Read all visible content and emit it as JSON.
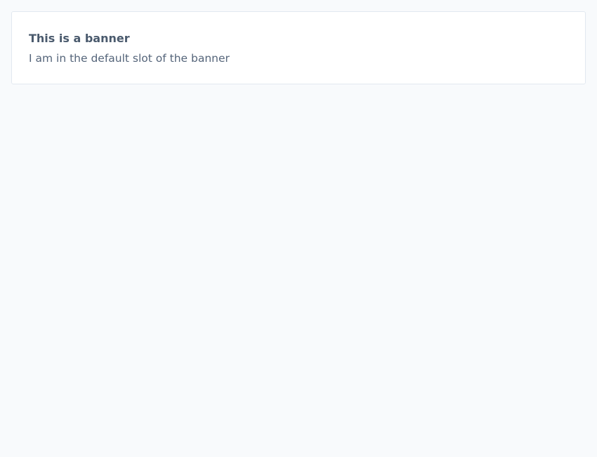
{
  "banner": {
    "title": "This is a banner",
    "body": "I am in the default slot of the banner"
  },
  "colors": {
    "page_background": "#f8fafc",
    "banner_background": "#ffffff",
    "banner_border": "#e2e8f0",
    "title_text": "#4a5a6d",
    "body_text": "#55657a"
  }
}
